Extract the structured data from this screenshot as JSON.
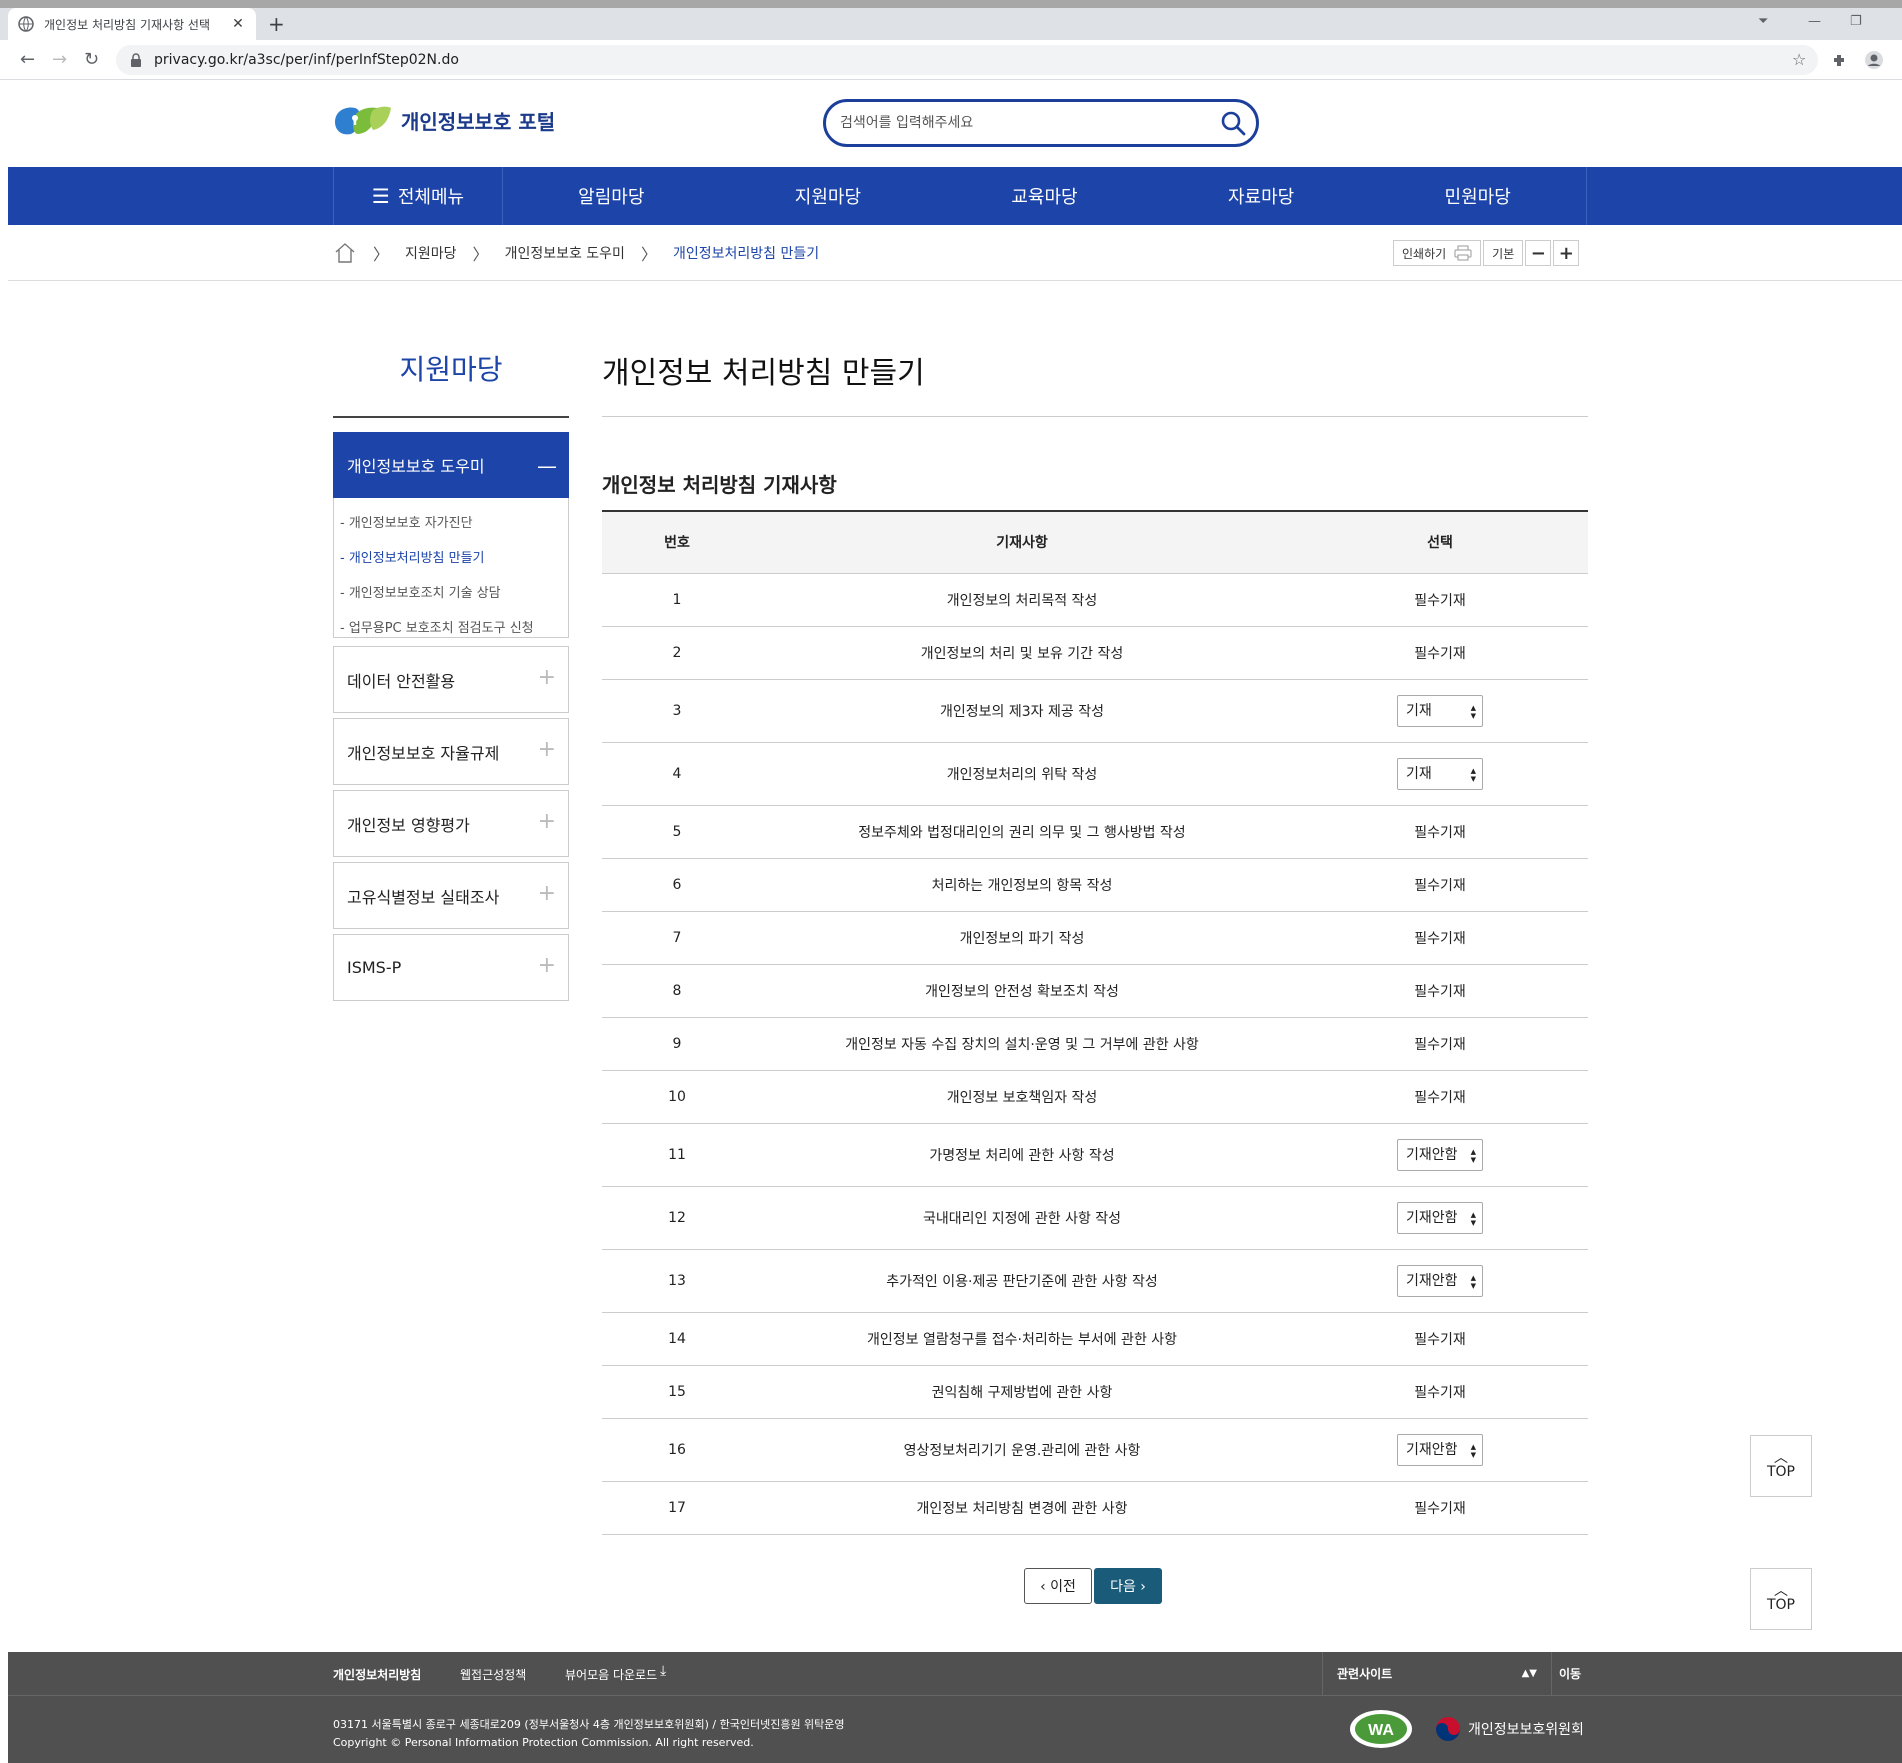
{
  "browser": {
    "tab_title": "개인정보 처리방침 기재사항 선택",
    "url": "privacy.go.kr/a3sc/per/inf/perInfStep02N.do"
  },
  "header": {
    "logo_text": "개인정보보호 포털",
    "search_placeholder": "검색어를 입력해주세요"
  },
  "gnb": {
    "all_menu": "전체메뉴",
    "items": [
      "알림마당",
      "지원마당",
      "교육마당",
      "자료마당",
      "민원마당"
    ]
  },
  "breadcrumb": {
    "items": [
      "지원마당",
      "개인정보보호 도우미",
      "개인정보처리방침 만들기"
    ]
  },
  "tools": {
    "print": "인쇄하기",
    "default": "기본",
    "minus": "−",
    "plus": "+"
  },
  "lnb": {
    "title": "지원마당",
    "active": "개인정보보호 도우미",
    "sub": [
      "- 개인정보보호 자가진단",
      "- 개인정보처리방침 만들기",
      "- 개인정보보호조치 기술 상담",
      "- 업무용PC 보호조치 점검도구 신청"
    ],
    "items": [
      "데이터 안전활용",
      "개인정보보호 자율규제",
      "개인정보 영향평가",
      "고유식별정보 실태조사",
      "ISMS-P"
    ]
  },
  "content": {
    "title": "개인정보 처리방침 만들기",
    "section_title": "개인정보 처리방침 기재사항",
    "table": {
      "headers": [
        "번호",
        "기재사항",
        "선택"
      ],
      "rows": [
        {
          "no": "1",
          "item": "개인정보의 처리목적 작성",
          "choice": "필수기재",
          "select": false
        },
        {
          "no": "2",
          "item": "개인정보의 처리 및 보유 기간 작성",
          "choice": "필수기재",
          "select": false
        },
        {
          "no": "3",
          "item": "개인정보의 제3자 제공 작성",
          "choice": "기재",
          "select": true
        },
        {
          "no": "4",
          "item": "개인정보처리의 위탁 작성",
          "choice": "기재",
          "select": true
        },
        {
          "no": "5",
          "item": "정보주체와 법정대리인의 권리 의무 및 그 행사방법 작성",
          "choice": "필수기재",
          "select": false
        },
        {
          "no": "6",
          "item": "처리하는 개인정보의 항목 작성",
          "choice": "필수기재",
          "select": false
        },
        {
          "no": "7",
          "item": "개인정보의 파기 작성",
          "choice": "필수기재",
          "select": false
        },
        {
          "no": "8",
          "item": "개인정보의 안전성 확보조치 작성",
          "choice": "필수기재",
          "select": false
        },
        {
          "no": "9",
          "item": "개인정보 자동 수집 장치의 설치·운영 및 그 거부에 관한 사항",
          "choice": "필수기재",
          "select": false
        },
        {
          "no": "10",
          "item": "개인정보 보호책임자 작성",
          "choice": "필수기재",
          "select": false
        },
        {
          "no": "11",
          "item": "가명정보 처리에 관한 사항 작성",
          "choice": "기재안함",
          "select": true
        },
        {
          "no": "12",
          "item": "국내대리인 지정에 관한 사항 작성",
          "choice": "기재안함",
          "select": true
        },
        {
          "no": "13",
          "item": "추가적인 이용·제공 판단기준에 관한 사항 작성",
          "choice": "기재안함",
          "select": true
        },
        {
          "no": "14",
          "item": "개인정보 열람청구를 접수·처리하는 부서에 관한 사항",
          "choice": "필수기재",
          "select": false
        },
        {
          "no": "15",
          "item": "권익침해 구제방법에 관한 사항",
          "choice": "필수기재",
          "select": false
        },
        {
          "no": "16",
          "item": "영상정보처리기기 운영.관리에 관한 사항",
          "choice": "기재안함",
          "select": true
        },
        {
          "no": "17",
          "item": "개인정보 처리방침 변경에 관한 사항",
          "choice": "필수기재",
          "select": false
        }
      ]
    },
    "prev": "‹ 이전",
    "next": "다음 ›"
  },
  "top_button": "TOP",
  "footer": {
    "links": [
      "개인정보처리방침",
      "웹접근성정책",
      "뷰어모음 다운로드"
    ],
    "related_sites": "관련사이트",
    "go": "이동",
    "address": "03171 서울특별시 종로구 세종대로209 (정부서울청사 4층 개인정보보호위원회) / 한국인터넷진흥원 위탁운영",
    "copyright": "Copyright © Personal Information Protection Commission. All right reserved.",
    "wa_mark": "WA",
    "org": "개인정보보호위원회"
  },
  "colors": {
    "brand_blue": "#1d44a8",
    "next_button": "#1b5b7a",
    "footer_bg": "#505050"
  }
}
